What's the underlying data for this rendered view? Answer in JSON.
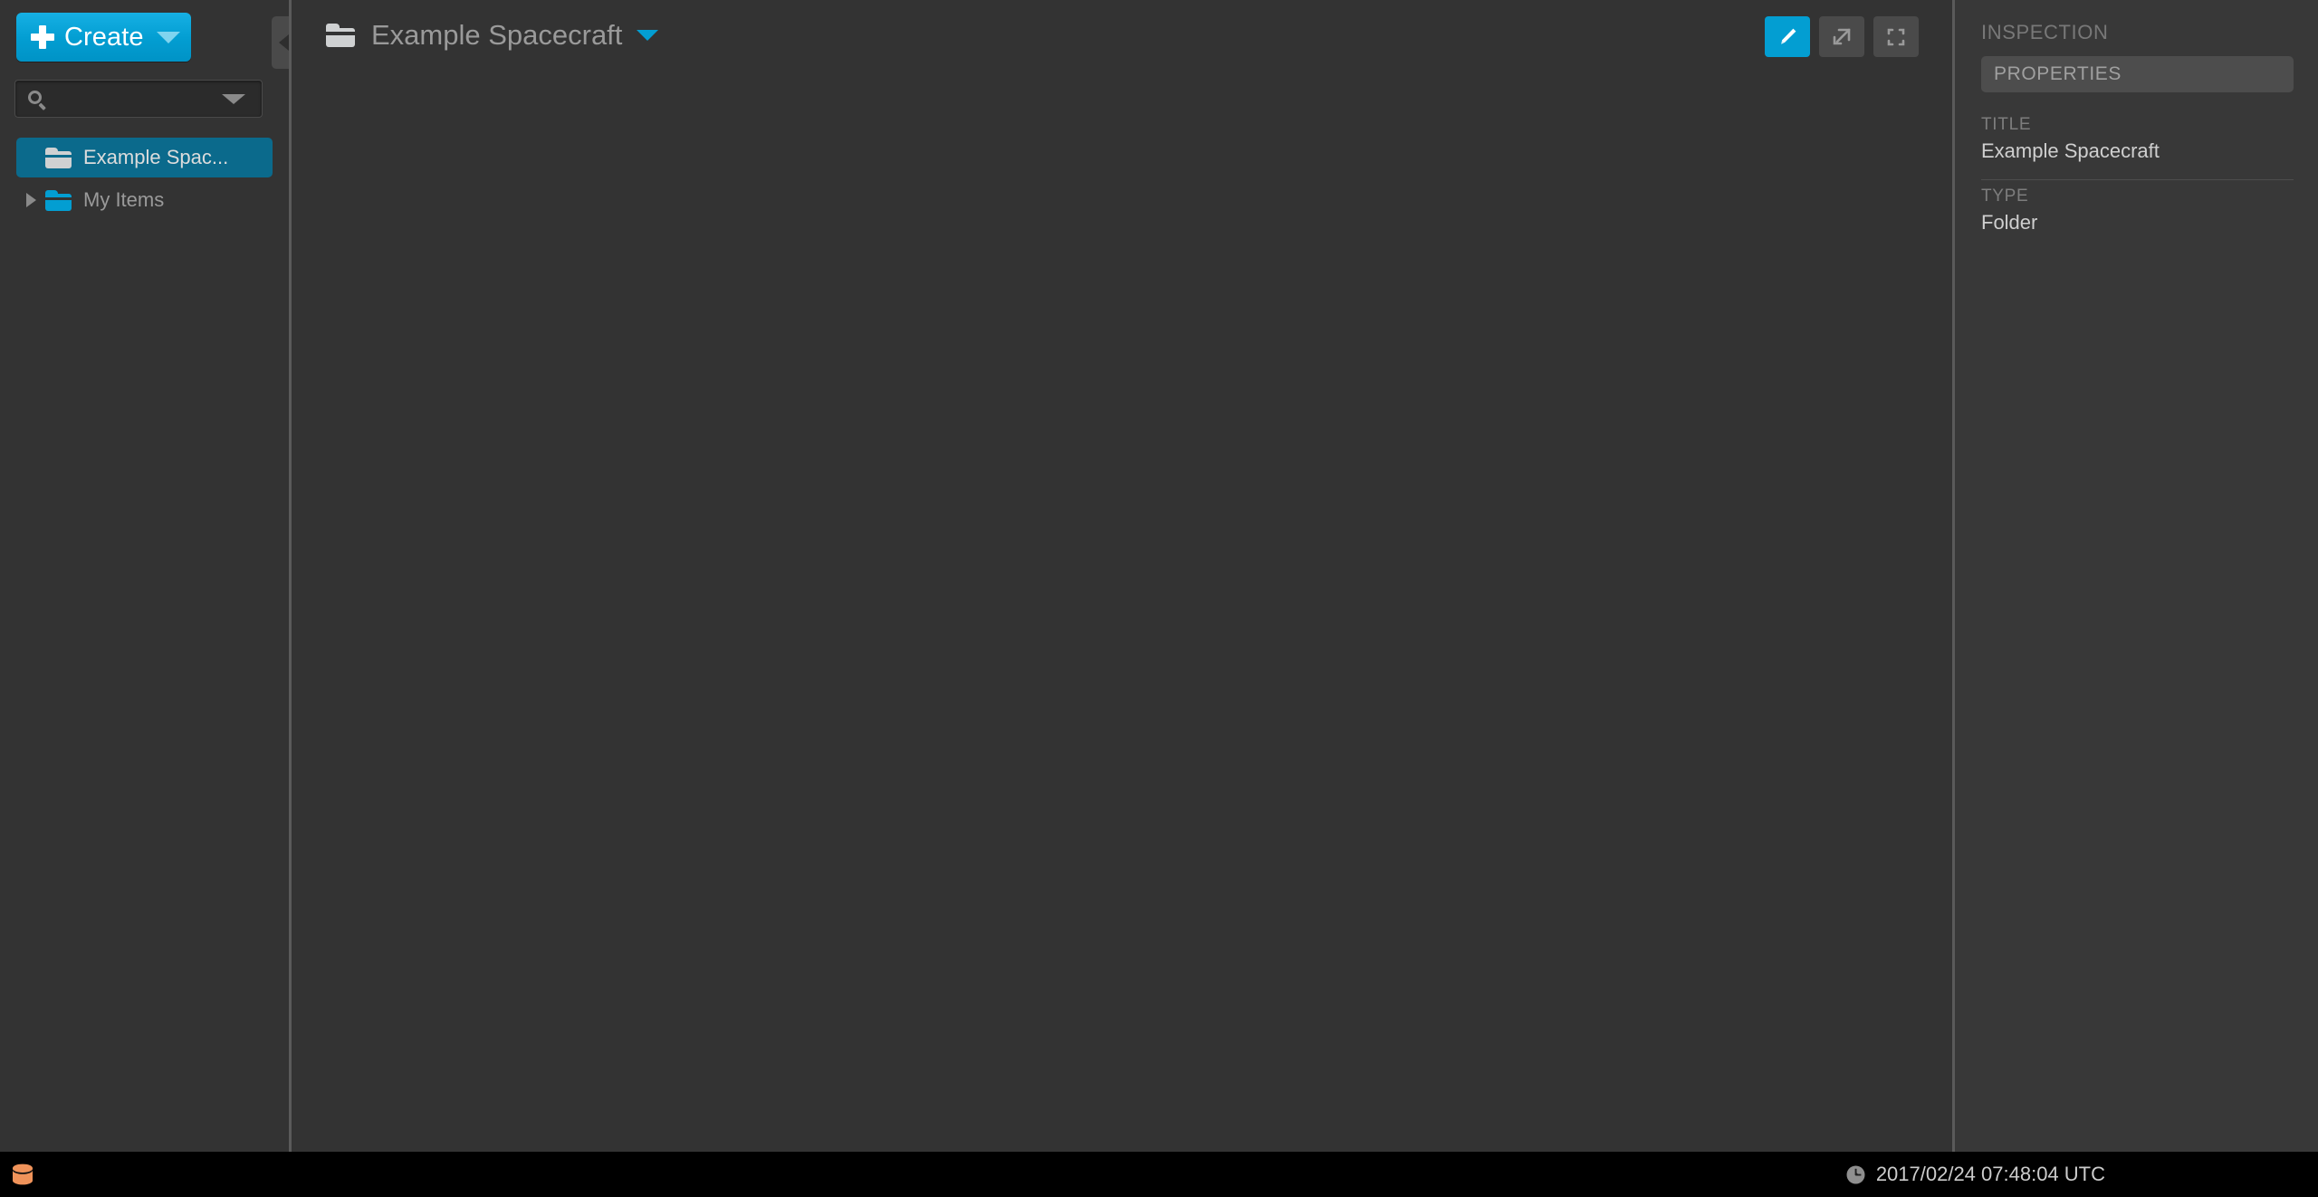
{
  "sidebar": {
    "create": {
      "label": "Create",
      "icon": "plus-icon",
      "caret": "chevron-down-icon"
    },
    "search": {
      "value": "",
      "placeholder": "",
      "icon": "search-icon",
      "caret": "chevron-down-icon"
    },
    "tree": [
      {
        "label": "Example Spac...",
        "icon": "folder-icon",
        "selected": true,
        "expandable": false,
        "folder_color": "#cfd1d2"
      },
      {
        "label": "My Items",
        "icon": "folder-icon",
        "selected": false,
        "expandable": true,
        "folder_color": "#039ed2"
      }
    ],
    "collapse_handle": "collapse-left-icon"
  },
  "main": {
    "breadcrumb": {
      "title": "Example Spacecraft",
      "icon": "folder-icon",
      "caret": "chevron-down-icon"
    },
    "toolbar": [
      {
        "name": "edit-button",
        "icon": "pencil-icon",
        "active": true
      },
      {
        "name": "new-window-button",
        "icon": "external-link-icon",
        "active": false
      },
      {
        "name": "fullscreen-button",
        "icon": "expand-icon",
        "active": false
      }
    ]
  },
  "inspector": {
    "header": "INSPECTION",
    "tab": "PROPERTIES",
    "properties": [
      {
        "key": "TITLE",
        "value": "Example Spacecraft"
      },
      {
        "key": "TYPE",
        "value": "Folder"
      }
    ],
    "collapse_handle": "collapse-right-icon"
  },
  "statusbar": {
    "database_icon": "database-icon",
    "clock_icon": "clock-icon",
    "timestamp": "2017/02/24 07:48:04 UTC"
  },
  "colors": {
    "accent_blue": "#039ed2",
    "selected_teal": "#0b6a8c",
    "panel_bg": "#333333",
    "inspector_bg": "#383838",
    "statusbar_bg": "#000000",
    "database_orange": "#f0935a"
  }
}
